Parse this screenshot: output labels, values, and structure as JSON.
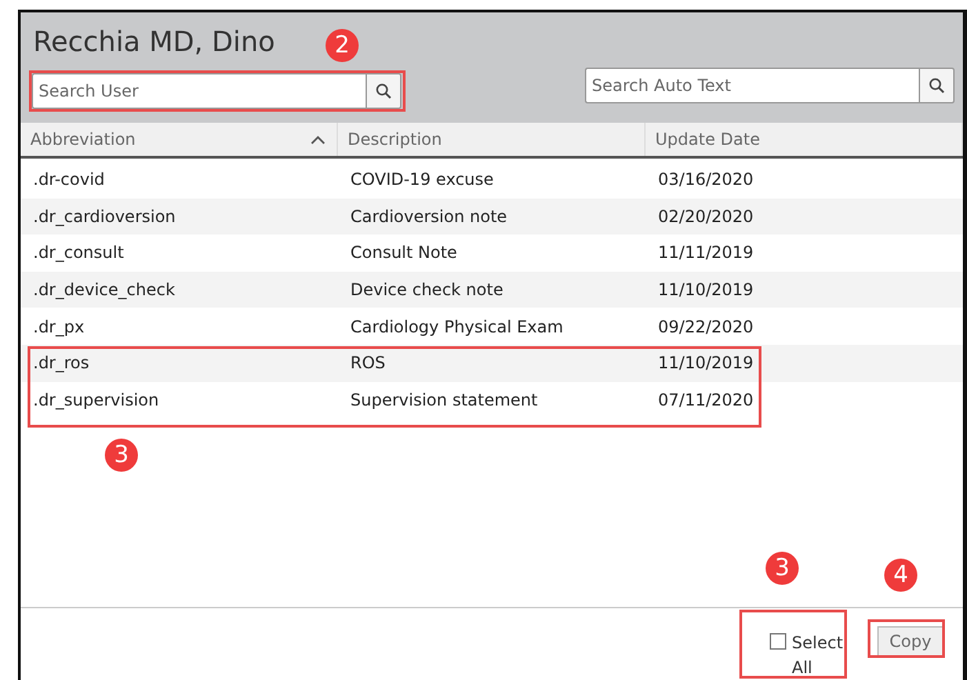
{
  "window": {
    "title": "Recchia MD, Dino"
  },
  "search_user": {
    "placeholder": "Search User"
  },
  "search_auto_text": {
    "placeholder": "Search Auto Text"
  },
  "table": {
    "columns": [
      {
        "label": "Abbreviation",
        "sorted": true
      },
      {
        "label": "Description",
        "sorted": false
      },
      {
        "label": "Update Date",
        "sorted": false
      }
    ],
    "rows": [
      {
        "cells": [
          ".dr-covid",
          "COVID-19 excuse",
          "03/16/2020"
        ]
      },
      {
        "cells": [
          ".dr_cardioversion",
          "Cardioversion note",
          "02/20/2020"
        ]
      },
      {
        "cells": [
          ".dr_consult",
          "Consult Note",
          "11/11/2019"
        ]
      },
      {
        "cells": [
          ".dr_device_check",
          "Device check note",
          "11/10/2019"
        ]
      },
      {
        "cells": [
          ".dr_px",
          "Cardiology Physical Exam",
          "09/22/2020"
        ]
      },
      {
        "cells": [
          ".dr_ros",
          "ROS",
          "11/10/2019"
        ]
      },
      {
        "cells": [
          ".dr_supervision",
          "Supervision statement",
          "07/11/2020"
        ]
      }
    ]
  },
  "select_all": {
    "label": "Select All",
    "checked": false
  },
  "copy_button": {
    "label": "Copy"
  },
  "callouts": [
    {
      "label": "2"
    },
    {
      "label": "3"
    },
    {
      "label": "3"
    },
    {
      "label": "4"
    }
  ]
}
